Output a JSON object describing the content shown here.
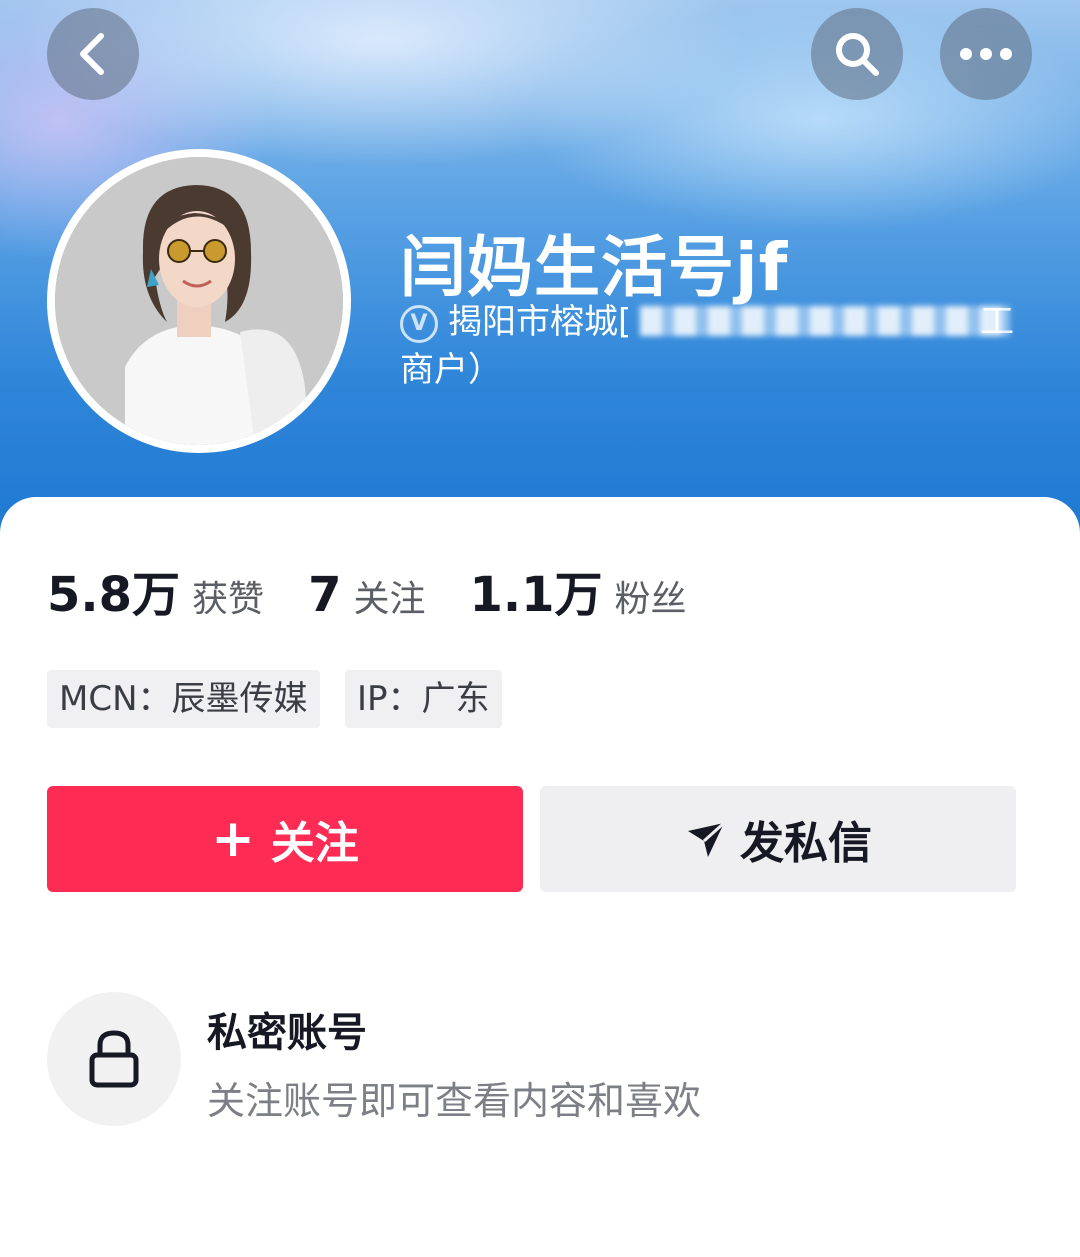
{
  "header": {
    "back_icon": "chevron-left-icon",
    "search_icon": "search-icon",
    "more_icon": "more-dots-icon"
  },
  "profile": {
    "name": "闫妈生活号jf",
    "verify_icon_label": "V",
    "verify_line1": "揭阳市榕城[",
    "verify_line1_tail": "工",
    "verify_line2": "商户）"
  },
  "stats": [
    {
      "num": "5.8万",
      "label": "获赞"
    },
    {
      "num": "7",
      "label": "关注"
    },
    {
      "num": "1.1万",
      "label": "粉丝"
    }
  ],
  "tags": {
    "mcn": "MCN：辰墨传媒",
    "ip": "IP：广东"
  },
  "actions": {
    "follow_label": "关注",
    "follow_plus": "+",
    "message_label": "发私信",
    "follow_color": "#fe2c55"
  },
  "private": {
    "title": "私密账号",
    "desc": "关注账号即可查看内容和喜欢",
    "icon": "lock-icon"
  }
}
